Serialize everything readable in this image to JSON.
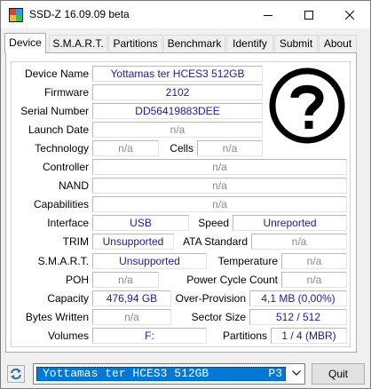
{
  "window": {
    "title": "SSD-Z 16.09.09 beta"
  },
  "tabs": [
    "Device",
    "S.M.A.R.T.",
    "Partitions",
    "Benchmark",
    "Identify",
    "Submit",
    "About"
  ],
  "device": {
    "device_name": {
      "label": "Device Name",
      "value": "Yottamas ter HCES3 512GB"
    },
    "firmware": {
      "label": "Firmware",
      "value": "2102"
    },
    "serial_number": {
      "label": "Serial Number",
      "value": "DD56419883DEE"
    },
    "launch_date": {
      "label": "Launch Date",
      "value": "n/a"
    },
    "technology": {
      "label": "Technology",
      "value": "n/a"
    },
    "cells": {
      "label": "Cells",
      "value": "n/a"
    },
    "controller": {
      "label": "Controller",
      "value": "n/a"
    },
    "nand": {
      "label": "NAND",
      "value": "n/a"
    },
    "capabilities": {
      "label": "Capabilities",
      "value": "n/a"
    },
    "interface": {
      "label": "Interface",
      "value": "USB"
    },
    "speed": {
      "label": "Speed",
      "value": "Unreported"
    },
    "trim": {
      "label": "TRIM",
      "value": "Unsupported"
    },
    "ata_standard": {
      "label": "ATA Standard",
      "value": "n/a"
    },
    "smart": {
      "label": "S.M.A.R.T.",
      "value": "Unsupported"
    },
    "temperature": {
      "label": "Temperature",
      "value": "n/a"
    },
    "poh": {
      "label": "POH",
      "value": "n/a"
    },
    "power_cycle_count": {
      "label": "Power Cycle Count",
      "value": "n/a"
    },
    "capacity": {
      "label": "Capacity",
      "value": "476,94 GB"
    },
    "over_provision": {
      "label": "Over-Provision",
      "value": "4,1 MB (0,00%)"
    },
    "bytes_written": {
      "label": "Bytes Written",
      "value": "n/a"
    },
    "sector_size": {
      "label": "Sector Size",
      "value": "512 / 512"
    },
    "volumes": {
      "label": "Volumes",
      "value": "F:"
    },
    "partitions": {
      "label": "Partitions",
      "value": "1 / 4 (MBR)"
    }
  },
  "drive_select": {
    "value": "Yottamas ter HCES3 512GB",
    "slot": "P3"
  },
  "buttons": {
    "quit": "Quit"
  },
  "icons": {
    "app": "ssd-z-icon",
    "unknown_logo": "question-mark-icon",
    "refresh": "refresh-icon",
    "dropdown": "chevron-down-icon"
  },
  "colors": {
    "value_text": "#1c1c96",
    "na_text": "#8a8a8a",
    "selection": "#0078d7"
  }
}
